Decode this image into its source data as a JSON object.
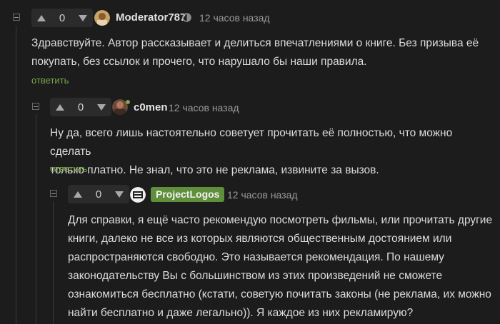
{
  "comments": [
    {
      "votes": "0",
      "username": "Moderator787",
      "time": "12 часов назад",
      "text_lines": [
        "Здравствуйте. Автор рассказывает и делиться впечатлениями о книге. Без призыва её",
        "покупать, без ссылок и прочего, что нарушало бы наши правила."
      ],
      "reply_label": "ответить"
    },
    {
      "votes": "0",
      "username": "c0men",
      "time": "12 часов назад",
      "text_lines": [
        "Ну да, всего лишь настоятельно советует прочитать её полностью, что можно сделать",
        "только платно. Не знал, что это не реклама, извините за вызов."
      ],
      "reply_label": "ответить"
    },
    {
      "votes": "0",
      "username": "ProjectLogos",
      "time": "12 часов назад",
      "text_lines": [
        "Для справки, я ещё часто рекомендую посмотреть фильмы, или прочитать другие",
        "книги, далеко не все из которых являются общественным достоянием или",
        "распространяются свободно. Это называется рекомендация. По нашему",
        "законодательству Вы с большинством из этих произведений не сможете",
        "ознакомиться бесплатно (кстати, советую почитать законы (не реклама, их можно",
        "найти бесплатно и даже легально)). Я каждое из них рекламирую?"
      ]
    }
  ],
  "colors": {
    "background": "#1c1c1c",
    "accent_green": "#7ba749",
    "badge_green": "#5f8f3a"
  }
}
